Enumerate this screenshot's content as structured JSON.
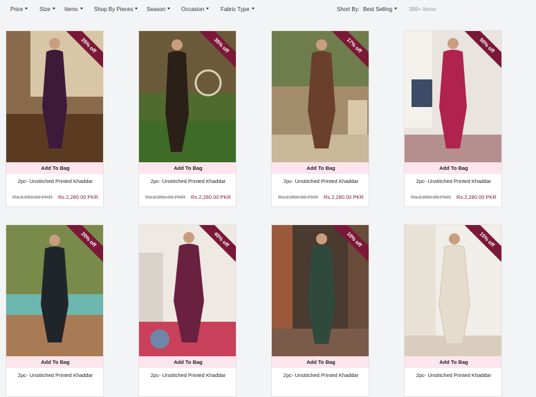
{
  "filters": [
    {
      "label": "Price"
    },
    {
      "label": "Size"
    },
    {
      "label": "Items"
    },
    {
      "label": "Shop By Pieces"
    },
    {
      "label": "Season"
    },
    {
      "label": "Occasion"
    },
    {
      "label": "Fabric Type"
    }
  ],
  "sort": {
    "label": "Short By:",
    "value": "Best Selling"
  },
  "count_text": "399+ items",
  "products": [
    {
      "discount": "25% off",
      "add_label": "Add To Bag",
      "title": "2pc- Unstitched Printed Khaddar",
      "old_price": "Rs.2,850.00 PKR",
      "new_price": "Rs.2,280.00 PKR",
      "outfit_color": "#3d1a3a"
    },
    {
      "discount": "35% off",
      "add_label": "Add To Bag",
      "title": "2pc- Unstitched Printed Khaddar",
      "old_price": "Rs.2,850.00 PKR",
      "new_price": "Rs.2,280.00 PKR",
      "outfit_color": "#2b2018"
    },
    {
      "discount": "17% off",
      "add_label": "Add To Bag",
      "title": "2pc- Unstitched Printed Khaddar",
      "old_price": "Rs.2,850.00 PKR",
      "new_price": "Rs.2,280.00 PKR",
      "outfit_color": "#6a3f2c"
    },
    {
      "discount": "50% off",
      "add_label": "Add To Bag",
      "title": "2pc- Unstitched Printed Khaddar",
      "old_price": "Rs.2,850.00 PKR",
      "new_price": "Rs.2,280.00 PKR",
      "outfit_color": "#b0234f"
    },
    {
      "discount": "20% off",
      "add_label": "Add To Bag",
      "title": "2pc- Unstitched Printed Khaddar",
      "outfit_color": "#20252a"
    },
    {
      "discount": "40% off",
      "add_label": "Add To Bag",
      "title": "2pc- Unstitched Printed Khaddar",
      "outfit_color": "#6a2140"
    },
    {
      "discount": "10% off",
      "add_label": "Add To Bag",
      "title": "2pc- Unstitched Printed Khaddar",
      "outfit_color": "#2f4a3c"
    },
    {
      "discount": "15% off",
      "add_label": "Add To Bag",
      "title": "2pc- Unstitched Printed Khaddar",
      "outfit_color": "#e6dccb"
    }
  ],
  "colors": {
    "ribbon": "#7b1838",
    "add_to_bag_bg": "#fde5ee",
    "sale_price": "#7b1838"
  }
}
